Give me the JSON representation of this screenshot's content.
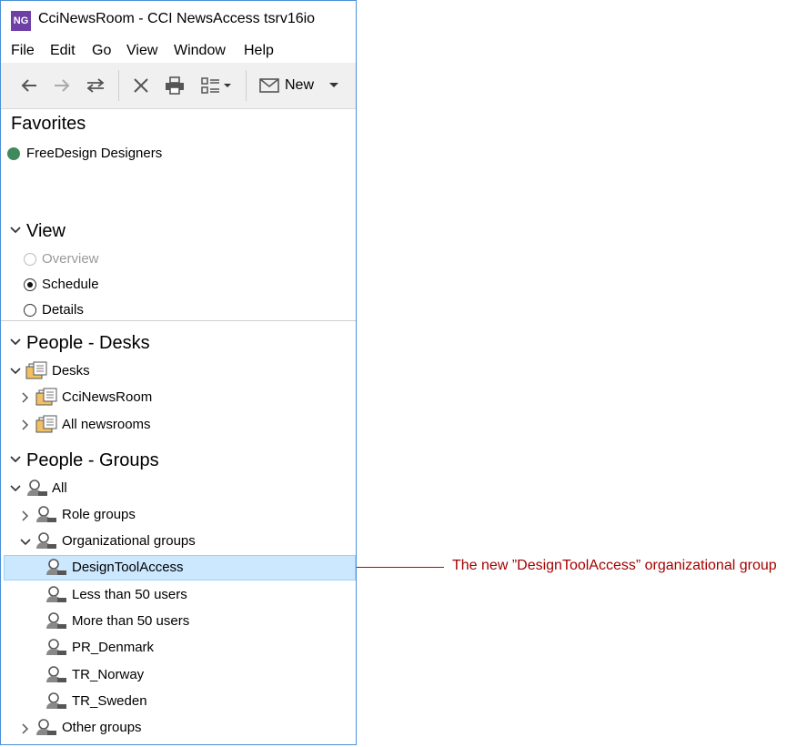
{
  "window": {
    "app_badge": "NG",
    "title": "CciNewsRoom - CCI NewsAccess tsrv16io"
  },
  "menu": [
    "File",
    "Edit",
    "Go",
    "View",
    "Window",
    "Help"
  ],
  "toolbar": {
    "new_label": "New"
  },
  "favorites": {
    "title": "Favorites",
    "items": [
      "FreeDesign Designers"
    ],
    "dot_color": "#3f8a5c"
  },
  "view": {
    "title": "View",
    "options": [
      {
        "label": "Overview",
        "state": "disabled"
      },
      {
        "label": "Schedule",
        "state": "checked"
      },
      {
        "label": "Details",
        "state": "unchecked"
      }
    ]
  },
  "people_desks": {
    "title": "People - Desks",
    "root": "Desks",
    "children": [
      "CciNewsRoom",
      "All newsrooms"
    ]
  },
  "people_groups": {
    "title": "People - Groups",
    "root": "All",
    "role_groups": "Role groups",
    "org_groups": "Organizational groups",
    "org_children": [
      "DesignToolAccess",
      "Less than 50 users",
      "More than 50 users",
      "PR_Denmark",
      "TR_Norway",
      "TR_Sweden"
    ],
    "other_groups": "Other groups",
    "selected": "DesignToolAccess"
  },
  "annotation": {
    "text": "The new ”DesignToolAccess” organizational group",
    "color": "#a40000"
  }
}
